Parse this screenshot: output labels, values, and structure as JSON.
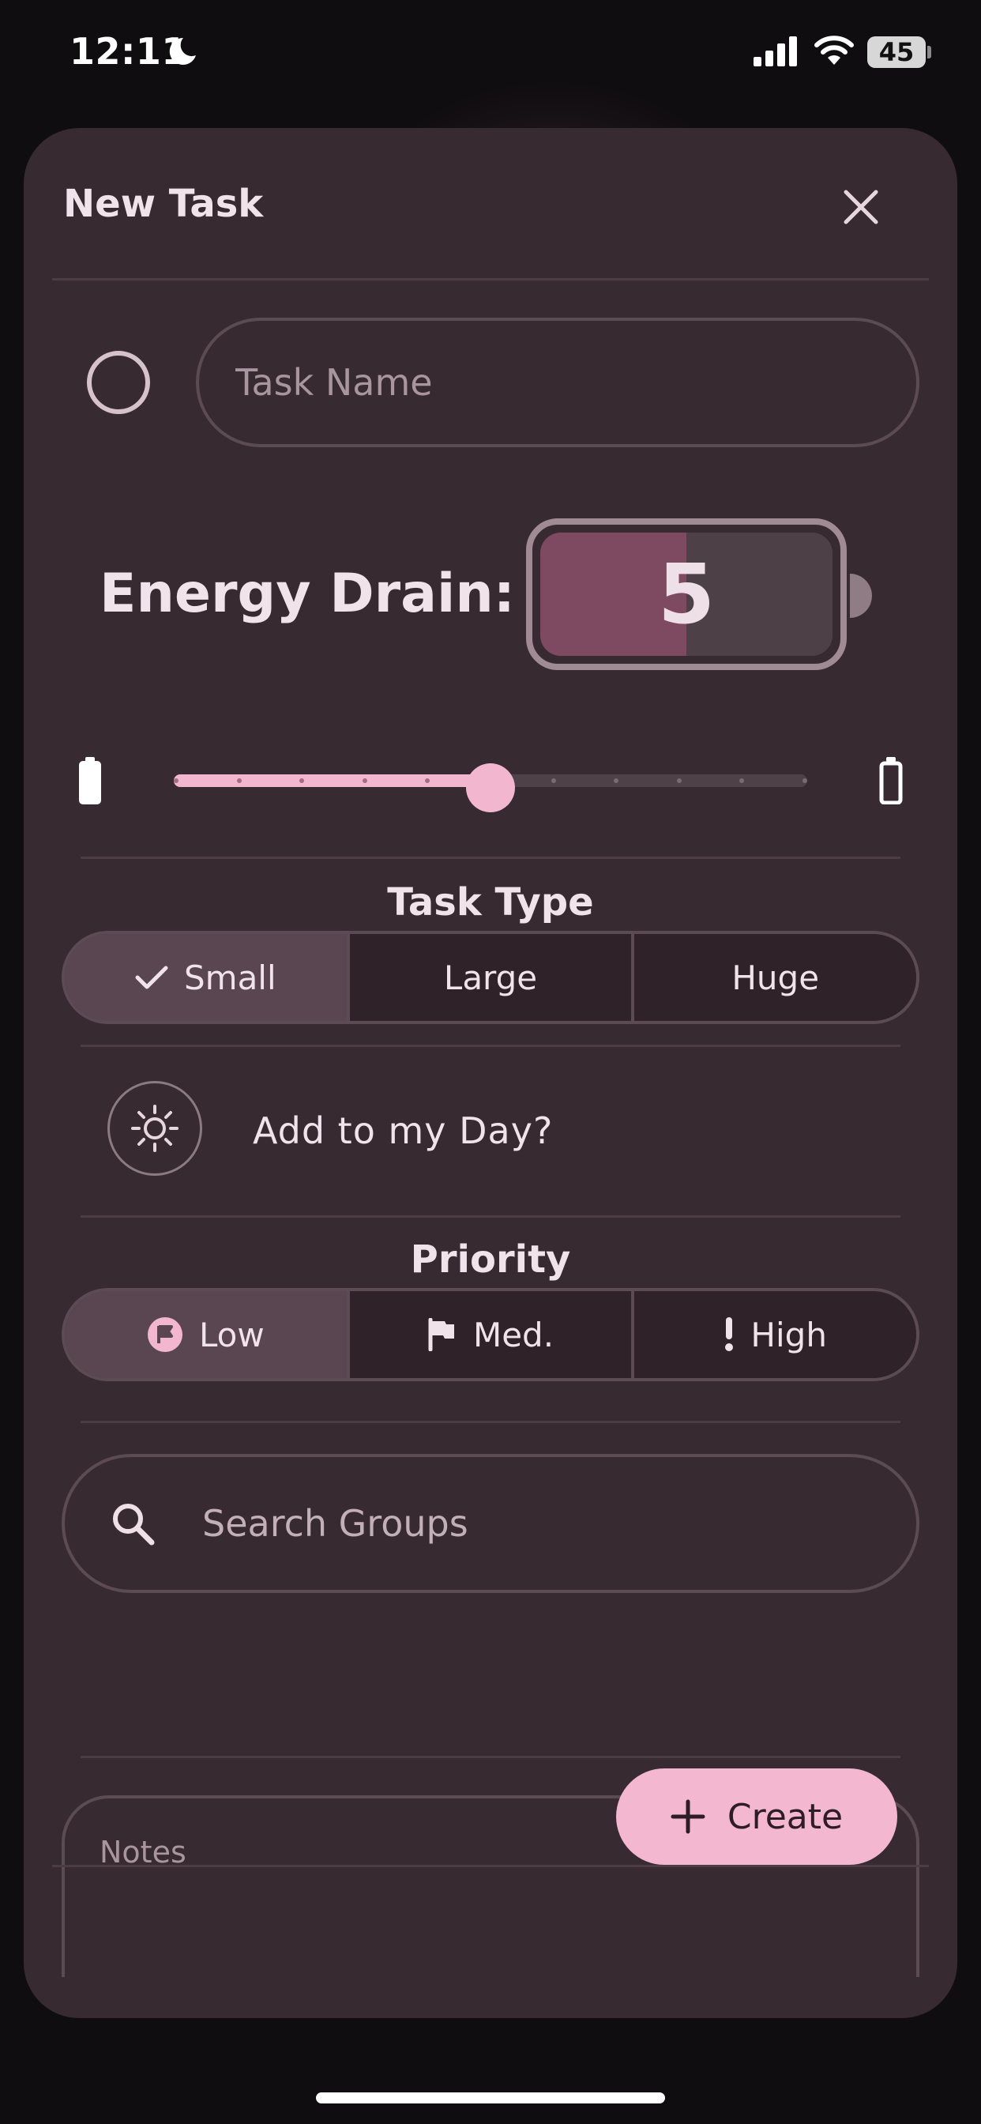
{
  "status_bar": {
    "time": "12:11",
    "battery_percent": "45",
    "icons": [
      "moon-icon",
      "cellular-signal-icon",
      "wifi-icon",
      "battery-icon"
    ]
  },
  "sheet": {
    "title": "New Task",
    "close_icon": "close-icon"
  },
  "task_name": {
    "placeholder": "Task Name",
    "value": ""
  },
  "energy": {
    "label": "Energy Drain:",
    "value": "5",
    "level_fraction": 0.5,
    "slider_min_icon": "battery-full-icon",
    "slider_max_icon": "battery-empty-icon"
  },
  "task_type": {
    "label": "Task Type",
    "options": [
      "Small",
      "Large",
      "Huge"
    ],
    "selected": "Small"
  },
  "my_day": {
    "label": "Add to my Day?",
    "icon": "sun-icon"
  },
  "priority": {
    "label": "Priority",
    "options": [
      "Low",
      "Med.",
      "High"
    ],
    "icons": [
      "flag-circle-icon",
      "flag-icon",
      "exclamation-icon"
    ],
    "selected": "Low"
  },
  "groups": {
    "placeholder": "Search Groups",
    "icon": "search-icon"
  },
  "notes": {
    "placeholder": "Notes"
  },
  "actions": {
    "create_label": "Create",
    "create_icon": "plus-icon"
  },
  "colors": {
    "background": "#0f0d0f",
    "sheet": "#372a30",
    "accent": "#f3b7d0",
    "battery_fill": "#7e4a61",
    "selected_segment": "#5a4650",
    "outline": "#5d4b53"
  }
}
